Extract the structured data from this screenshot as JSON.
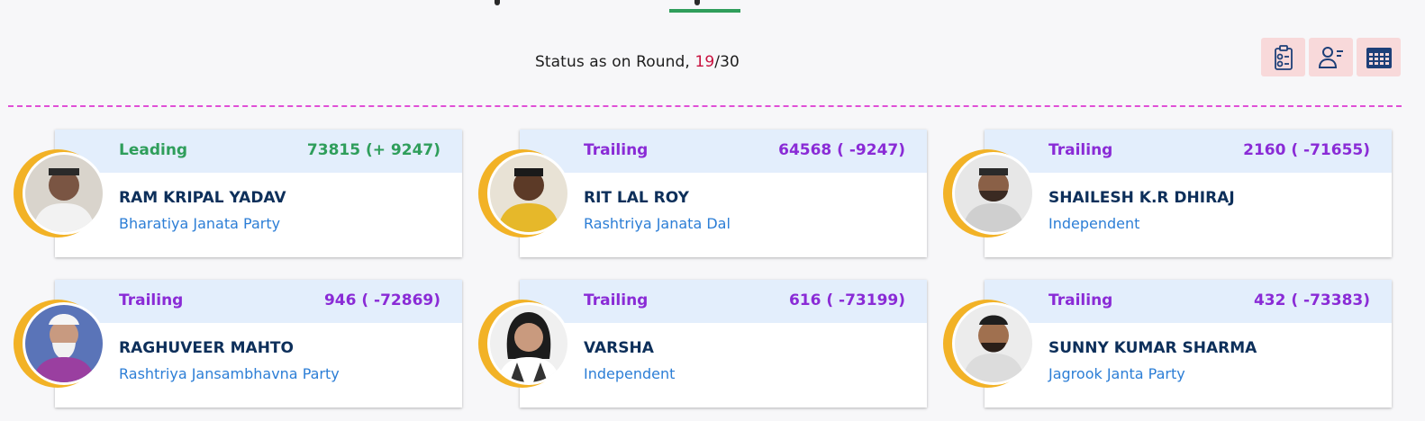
{
  "header": {
    "status_prefix": "Status as on Round, ",
    "round_current": "19",
    "round_total": "/30"
  },
  "toolbar": {
    "buttons": [
      {
        "icon": "clipboard-report-icon",
        "color": "#1d3f78"
      },
      {
        "icon": "user-list-icon",
        "color": "#1d3f78"
      },
      {
        "icon": "table-grid-icon",
        "color": "#1d3f78"
      }
    ]
  },
  "colors": {
    "leading": "#2f9e5b",
    "trailing": "#8a2bd6",
    "name": "#0d2f5a",
    "party": "#2c7ed6",
    "round_current": "#c8103e",
    "divider": "#e04fd6",
    "ring": "#f2b226"
  },
  "candidates": [
    {
      "status": "Leading",
      "votes": "73815 (+ 9247)",
      "name": "RAM KRIPAL YADAV",
      "party": "Bharatiya Janata Party"
    },
    {
      "status": "Trailing",
      "votes": "64568 ( -9247)",
      "name": "RIT LAL ROY",
      "party": "Rashtriya Janata Dal"
    },
    {
      "status": "Trailing",
      "votes": "2160 ( -71655)",
      "name": "SHAILESH K.R DHIRAJ",
      "party": "Independent"
    },
    {
      "status": "Trailing",
      "votes": "946 ( -72869)",
      "name": "RAGHUVEER MAHTO",
      "party": "Rashtriya Jansambhavna Party"
    },
    {
      "status": "Trailing",
      "votes": "616 ( -73199)",
      "name": "VARSHA",
      "party": "Independent"
    },
    {
      "status": "Trailing",
      "votes": "432 ( -73383)",
      "name": "SUNNY KUMAR SHARMA",
      "party": "Jagrook Janta Party"
    }
  ]
}
